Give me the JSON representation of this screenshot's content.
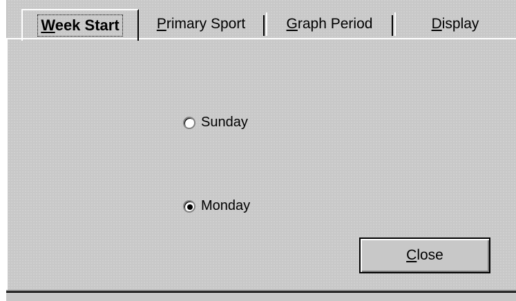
{
  "tabs": [
    {
      "label": "Week Start",
      "accel": "W",
      "rest": "eek Start",
      "active": true
    },
    {
      "label": "Primary Sport",
      "accel": "P",
      "rest": "rimary Sport",
      "active": false
    },
    {
      "label": "Graph Period",
      "accel": "G",
      "rest": "raph Period",
      "active": false
    },
    {
      "label": "Display",
      "accel": "D",
      "rest": "isplay",
      "active": false
    }
  ],
  "week_start": {
    "options": [
      {
        "label": "Sunday",
        "selected": false
      },
      {
        "label": "Monday",
        "selected": true
      }
    ]
  },
  "buttons": {
    "close_label": "Close",
    "close_accel": "C",
    "close_rest": "lose"
  },
  "colors": {
    "face": "#c8c8c8",
    "highlight": "#ffffff",
    "shadow": "#808080",
    "dark": "#000000"
  }
}
